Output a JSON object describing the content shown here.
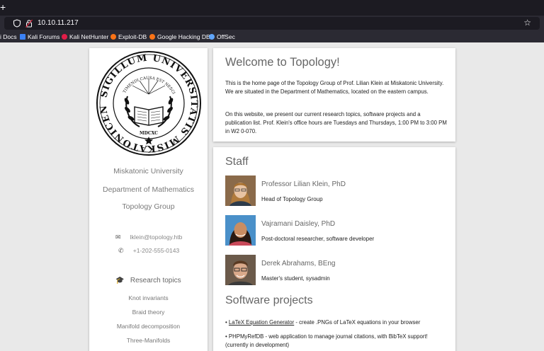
{
  "browser": {
    "new_tab": "+",
    "url": "10.10.11.217",
    "bookmarks": [
      {
        "label": "i Docs",
        "icon": "docs-icon",
        "color": "#3b82f6"
      },
      {
        "label": "Kali Forums",
        "icon": "kali-icon",
        "color": "#3b82f6"
      },
      {
        "label": "Kali NetHunter",
        "icon": "nethunter-icon",
        "color": "#e11d48"
      },
      {
        "label": "Exploit-DB",
        "icon": "exploitdb-icon",
        "color": "#f97316"
      },
      {
        "label": "Google Hacking DB",
        "icon": "ghdb-icon",
        "color": "#f97316"
      },
      {
        "label": "OffSec",
        "icon": "offsec-icon",
        "color": "#60a5fa"
      }
    ]
  },
  "sidebar": {
    "seal_text": [
      "SIGILLUM UNIVERSITATIS MISKATONICENSIS",
      "TIMENDI CAUSA EST NESCIRE",
      "MDCXC"
    ],
    "university": "Miskatonic University",
    "department": "Department of Mathematics",
    "group": "Topology Group",
    "email": "lklein@topology.htb",
    "phone": "+1-202-555-0143",
    "research_title": "Research topics",
    "research_topics": [
      "Knot invariants",
      "Braid theory",
      "Manifold decomposition",
      "Three-Manifolds"
    ]
  },
  "welcome": {
    "title": "Welcome to Topology!",
    "p1": "This is the home page of the Topology Group of Prof. Lilian Klein at Miskatonic University. We are situated in the Department of Mathematics, located on the eastern campus.",
    "p2": "On this website, we present our current research topics, software projects and a publication list. Prof. Klein's office hours are Tuesdays and Thursdays, 1:00 PM to 3:00 PM in W2 0-070."
  },
  "staff": {
    "title": "Staff",
    "members": [
      {
        "name": "Professor Lilian Klein, PhD",
        "role": "Head of Topology Group"
      },
      {
        "name": "Vajramani Daisley, PhD",
        "role": "Post-doctoral researcher, software developer"
      },
      {
        "name": "Derek Abrahams, BEng",
        "role": "Master's student, sysadmin"
      }
    ]
  },
  "software": {
    "title": "Software projects",
    "projects": [
      {
        "bullet": "•",
        "link": "LaTeX Equation Generator",
        "desc": " - create .PNGs of LaTeX equations in your browser"
      },
      {
        "bullet": "•",
        "link": "",
        "desc": "PHPMyRefDB - web application to manage journal citations, with BibTeX support! (currently in development)"
      }
    ]
  }
}
